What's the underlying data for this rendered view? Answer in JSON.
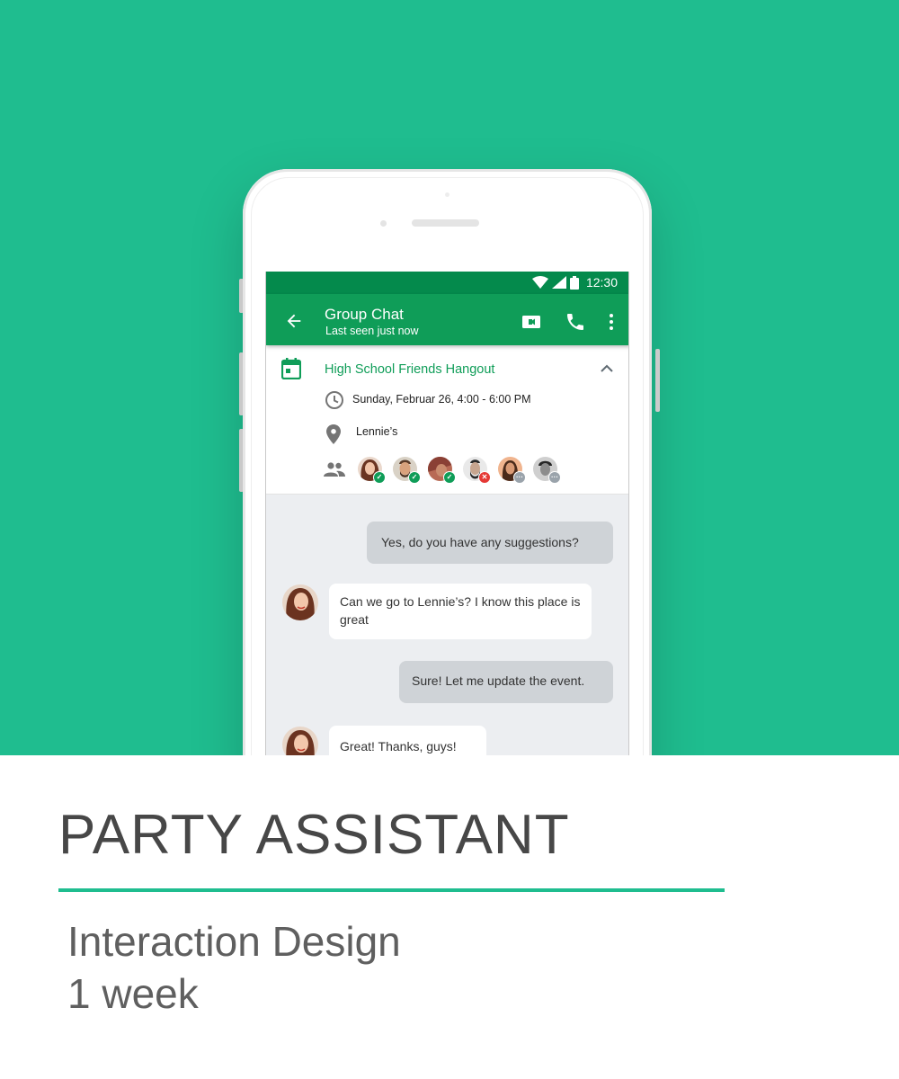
{
  "colors": {
    "hero_bg": "#1fbd8f",
    "appbar": "#0f9d58",
    "statusbar": "#048a4c",
    "accent": "#0f9d58"
  },
  "statusbar": {
    "time": "12:30",
    "icons": [
      "wifi-icon",
      "signal-icon",
      "battery-icon"
    ]
  },
  "appbar": {
    "title": "Group Chat",
    "subtitle": "Last seen just now",
    "actions": [
      "video-call-icon",
      "phone-icon",
      "more-vert-icon"
    ]
  },
  "event": {
    "title": "High School Friends Hangout",
    "datetime": "Sunday, Februar 26, 4:00 - 6:00 PM",
    "location": "Lennie’s",
    "guests": [
      {
        "status": "accepted"
      },
      {
        "status": "accepted"
      },
      {
        "status": "accepted"
      },
      {
        "status": "declined"
      },
      {
        "status": "pending"
      },
      {
        "status": "pending"
      }
    ]
  },
  "messages": [
    {
      "direction": "out",
      "text": "Yes, do you have any suggestions?"
    },
    {
      "direction": "in",
      "text": "Can we go to Lennie’s?  I know this place is great"
    },
    {
      "direction": "out",
      "text": "Sure! Let me update the event."
    },
    {
      "direction": "in",
      "text": "Great! Thanks, guys!"
    }
  ],
  "project": {
    "title": "PARTY ASSISTANT",
    "discipline": "Interaction Design",
    "duration": "1 week"
  }
}
